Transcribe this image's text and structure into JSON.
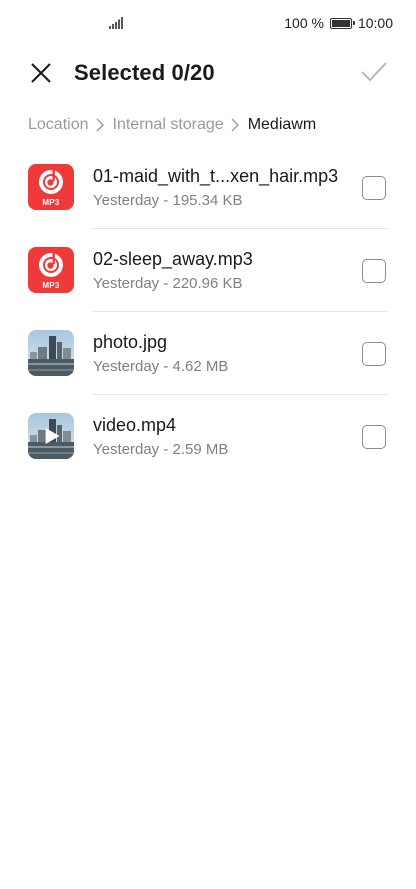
{
  "status_bar": {
    "battery_text": "100 %",
    "time": "10:00",
    "signal_icon": "signal-icon",
    "battery_icon": "battery-icon"
  },
  "header": {
    "title": "Selected 0/20",
    "close_icon": "close-icon",
    "confirm_icon": "checkmark-icon"
  },
  "breadcrumb": {
    "items": [
      "Location",
      "Internal storage",
      "Mediawm"
    ],
    "separator_icon": "chevron-right-icon"
  },
  "files": [
    {
      "name": "01-maid_with_t...xen_hair.mp3",
      "meta": "Yesterday - 195.34 KB",
      "type": "mp3",
      "badge": "MP3",
      "selected": false
    },
    {
      "name": "02-sleep_away.mp3",
      "meta": "Yesterday - 220.96 KB",
      "type": "mp3",
      "badge": "MP3",
      "selected": false
    },
    {
      "name": "photo.jpg",
      "meta": "Yesterday - 4.62 MB",
      "type": "image",
      "selected": false
    },
    {
      "name": "video.mp4",
      "meta": "Yesterday - 2.59 MB",
      "type": "video",
      "selected": false
    }
  ],
  "colors": {
    "mp3_icon": "#f03a3a",
    "breadcrumb_inactive": "#9a9a9a",
    "meta_text": "#808080",
    "divider": "#e6e6e6"
  }
}
